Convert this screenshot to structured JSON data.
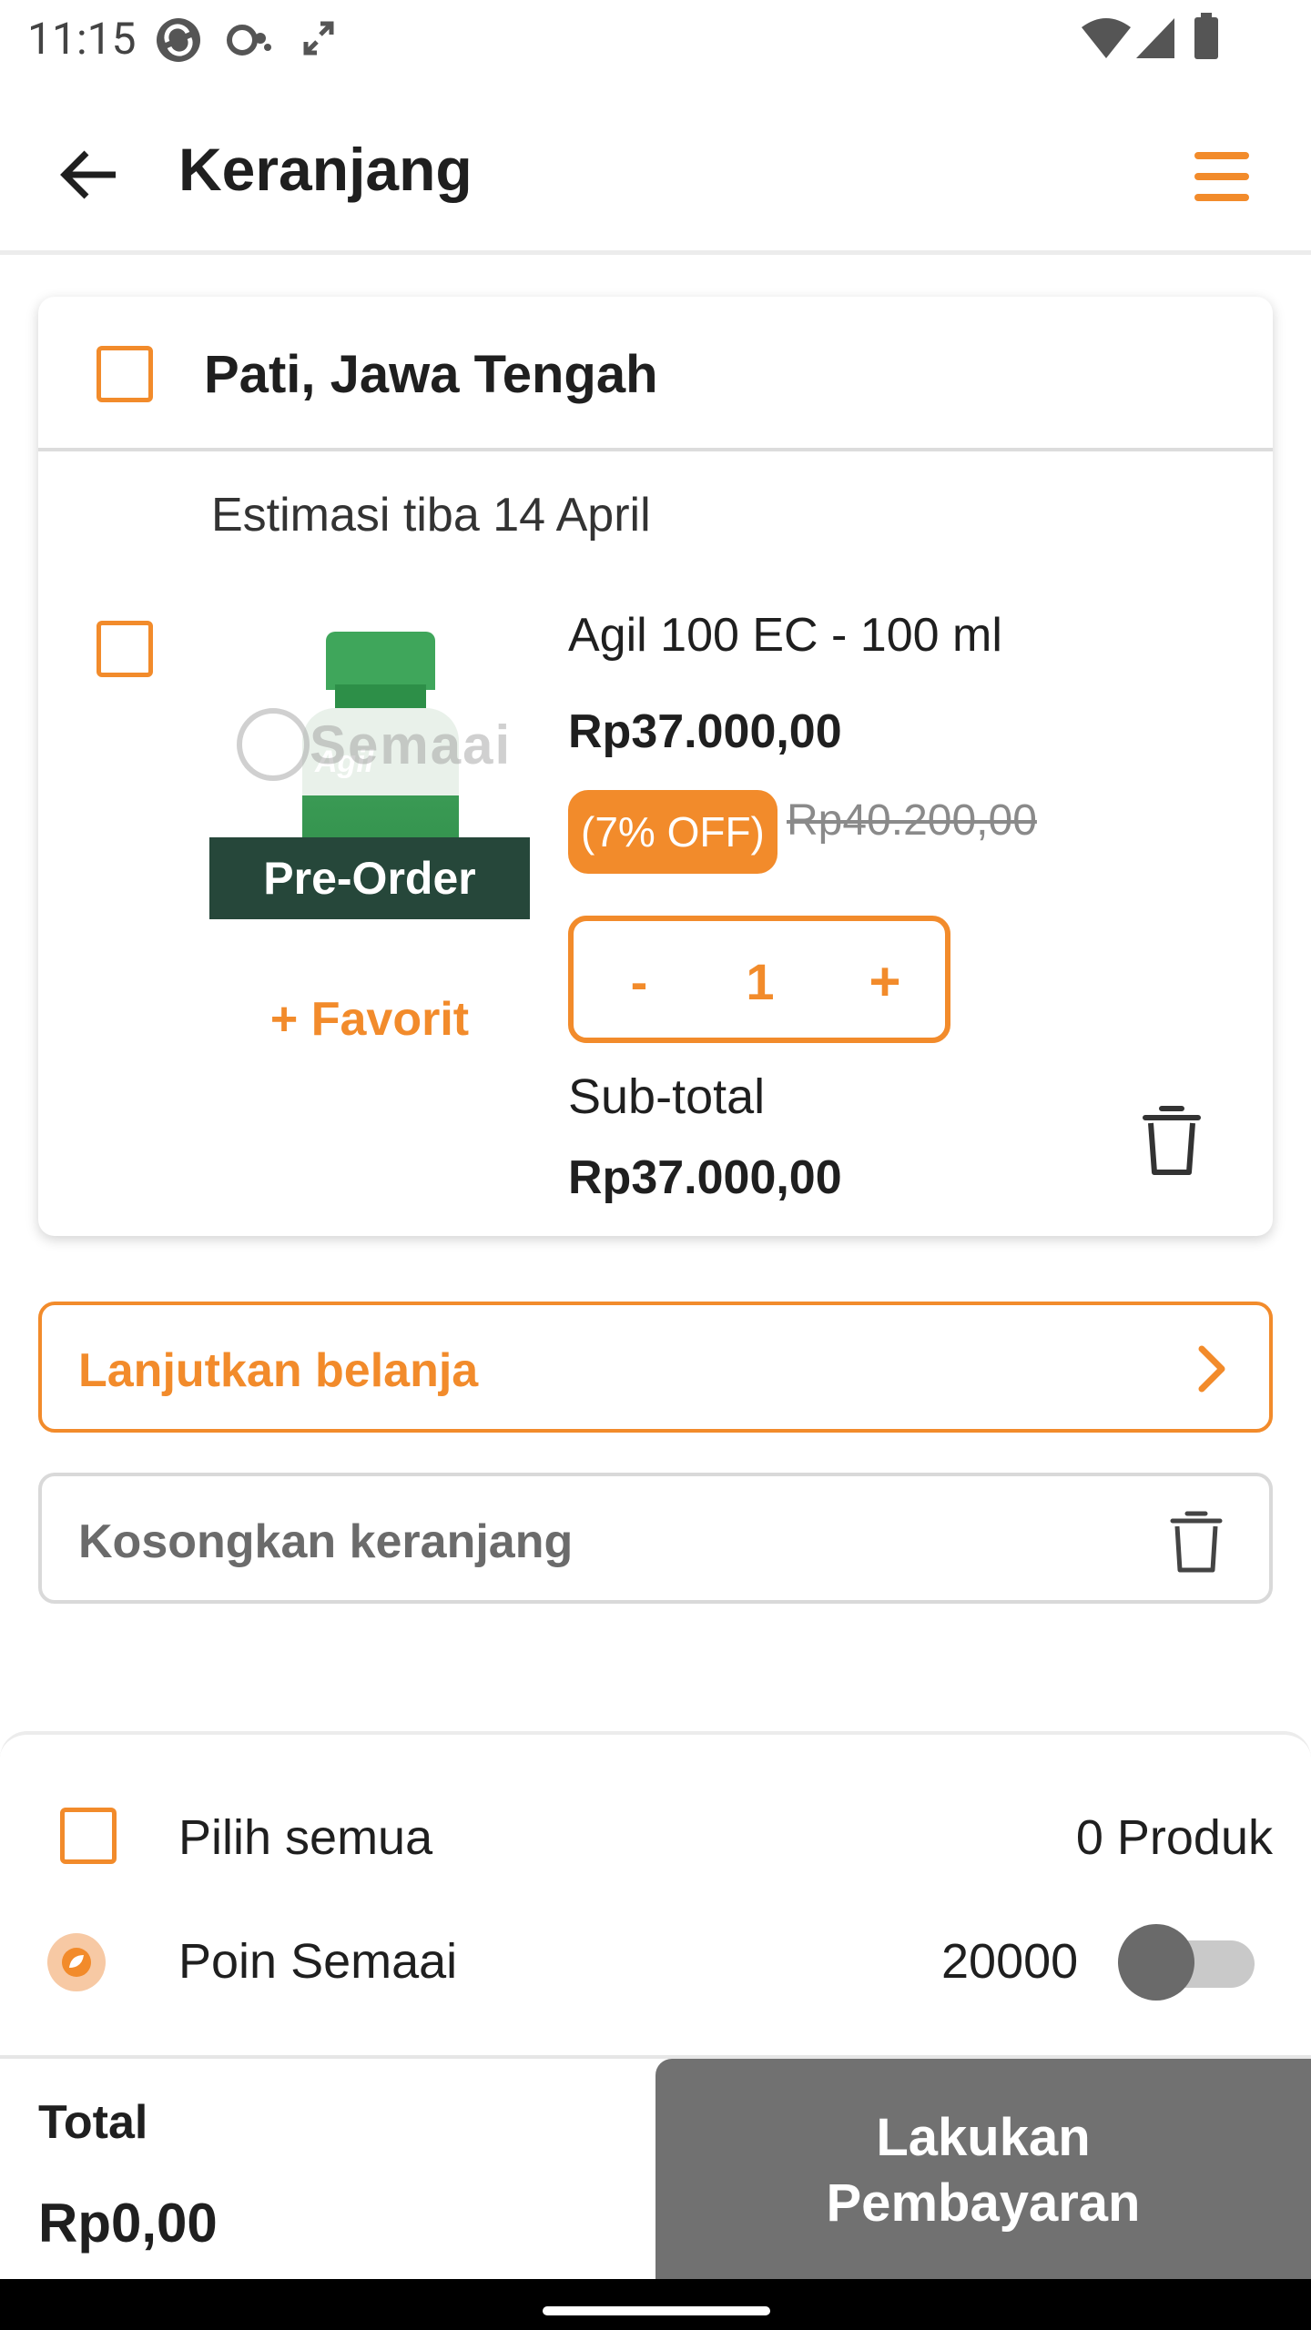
{
  "status_bar": {
    "time": "11:15",
    "icons_left": [
      "sync-icon",
      "cloud-icon",
      "expand-icon"
    ],
    "icons_right": [
      "wifi-icon",
      "signal-icon",
      "battery-icon"
    ]
  },
  "header": {
    "title": "Keranjang",
    "back_icon": "arrow-left-icon",
    "menu_icon": "hamburger-menu-icon"
  },
  "cart": {
    "store_name": "Pati, Jawa Tengah",
    "estimasi": "Estimasi tiba 14 April",
    "items": [
      {
        "name": "Agil 100 EC - 100 ml",
        "price": "Rp37.000,00",
        "discount_badge": "(7% OFF)",
        "original_price": "Rp40.200,00",
        "badge": "Pre-Order",
        "favorite_label": "+ Favorit",
        "qty_minus": "-",
        "quantity": "1",
        "qty_plus": "+",
        "subtotal_label": "Sub-total",
        "subtotal": "Rp37.000,00",
        "image_bottle_label": "Agil",
        "image_watermark": "Semaai"
      }
    ]
  },
  "actions": {
    "continue_label": "Lanjutkan belanja",
    "clear_label": "Kosongkan keranjang"
  },
  "summary": {
    "select_all_label": "Pilih semua",
    "product_count": "0 Produk",
    "points_label": "Poin Semaai",
    "points_value": "20000",
    "points_toggle": false,
    "total_label": "Total",
    "total_value": "Rp0,00",
    "pay_button": "Lakukan Pembayaran"
  },
  "colors": {
    "accent": "#f28b2b",
    "preorder_bg": "#26473a",
    "pay_button_bg": "#717171"
  }
}
